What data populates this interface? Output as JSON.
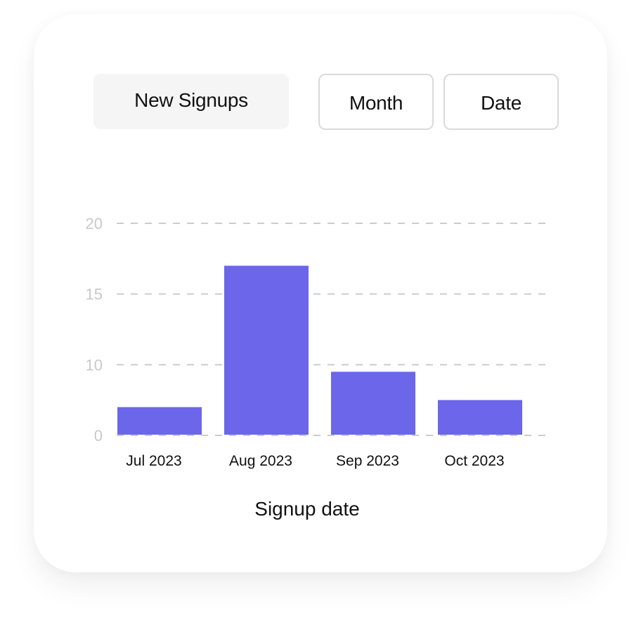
{
  "controls": {
    "metric_label": "New Signups",
    "dimension_labels": [
      "Month",
      "Date"
    ]
  },
  "colors": {
    "bar": "#6c66ea",
    "grid": "#cccccc",
    "ytick": "#c8c8c8"
  },
  "chart_data": {
    "type": "bar",
    "title": "",
    "xlabel": "Signup date",
    "ylabel": "",
    "categories": [
      "Jul 2023",
      "Aug 2023",
      "Sep 2023",
      "Oct 2023"
    ],
    "values": [
      4,
      17,
      9,
      5
    ],
    "y_ticks": [
      0,
      10,
      15,
      20
    ],
    "ylim": [
      0,
      20
    ],
    "grid": true,
    "grid_style": "dashed",
    "legend": "none"
  }
}
